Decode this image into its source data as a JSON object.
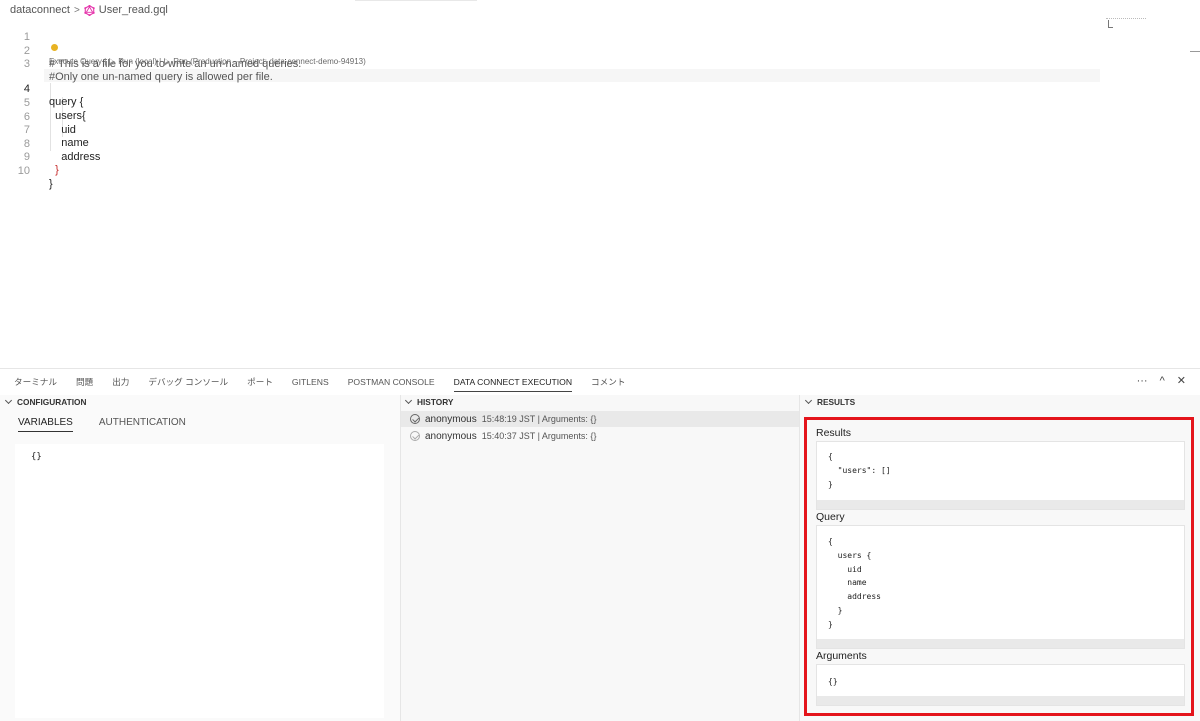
{
  "breadcrumb": {
    "folder": "dataconnect",
    "file": "User_read.gql"
  },
  "editor": {
    "lines": [
      {
        "n": "1",
        "text": ""
      },
      {
        "n": "2",
        "text": "# This is a file for you to write an un-named queries."
      },
      {
        "n": "3",
        "text": "#Only one un-named query is allowed per file."
      },
      {
        "n": "4",
        "text": "query {"
      },
      {
        "n": "5",
        "text": "  users{"
      },
      {
        "n": "6",
        "text": "    uid"
      },
      {
        "n": "7",
        "text": "    name"
      },
      {
        "n": "8",
        "text": "    address"
      },
      {
        "n": "9",
        "text": "  }"
      },
      {
        "n": "10",
        "text": "}"
      }
    ],
    "codelens": {
      "execute": "Execute Query |",
      "run_local": "Run (local) |",
      "run_prod": "Run (Production – Project: data-connect-demo-94913)"
    }
  },
  "panel": {
    "tabs": [
      "ターミナル",
      "問題",
      "出力",
      "デバッグ コンソール",
      "ポート",
      "GITLENS",
      "POSTMAN CONSOLE",
      "DATA CONNECT EXECUTION",
      "コメント"
    ],
    "active_tab": "DATA CONNECT EXECUTION",
    "actions": {
      "more": "···",
      "maximize": "^",
      "close": "✕"
    }
  },
  "configuration": {
    "header": "CONFIGURATION",
    "tabs": [
      "VARIABLES",
      "AUTHENTICATION"
    ],
    "variables_value": "{}"
  },
  "history": {
    "header": "HISTORY",
    "items": [
      {
        "user": "anonymous",
        "meta": "15:48:19 JST | Arguments: {}"
      },
      {
        "user": "anonymous",
        "meta": "15:40:37 JST | Arguments: {}"
      }
    ]
  },
  "results": {
    "header": "RESULTS",
    "results_label": "Results",
    "results_value": "{\n  \"users\": []\n}",
    "query_label": "Query",
    "query_value": "{\n  users {\n    uid\n    name\n    address\n  }\n}",
    "arguments_label": "Arguments",
    "arguments_value": "{}",
    "highlight_color": "#e4141b"
  }
}
